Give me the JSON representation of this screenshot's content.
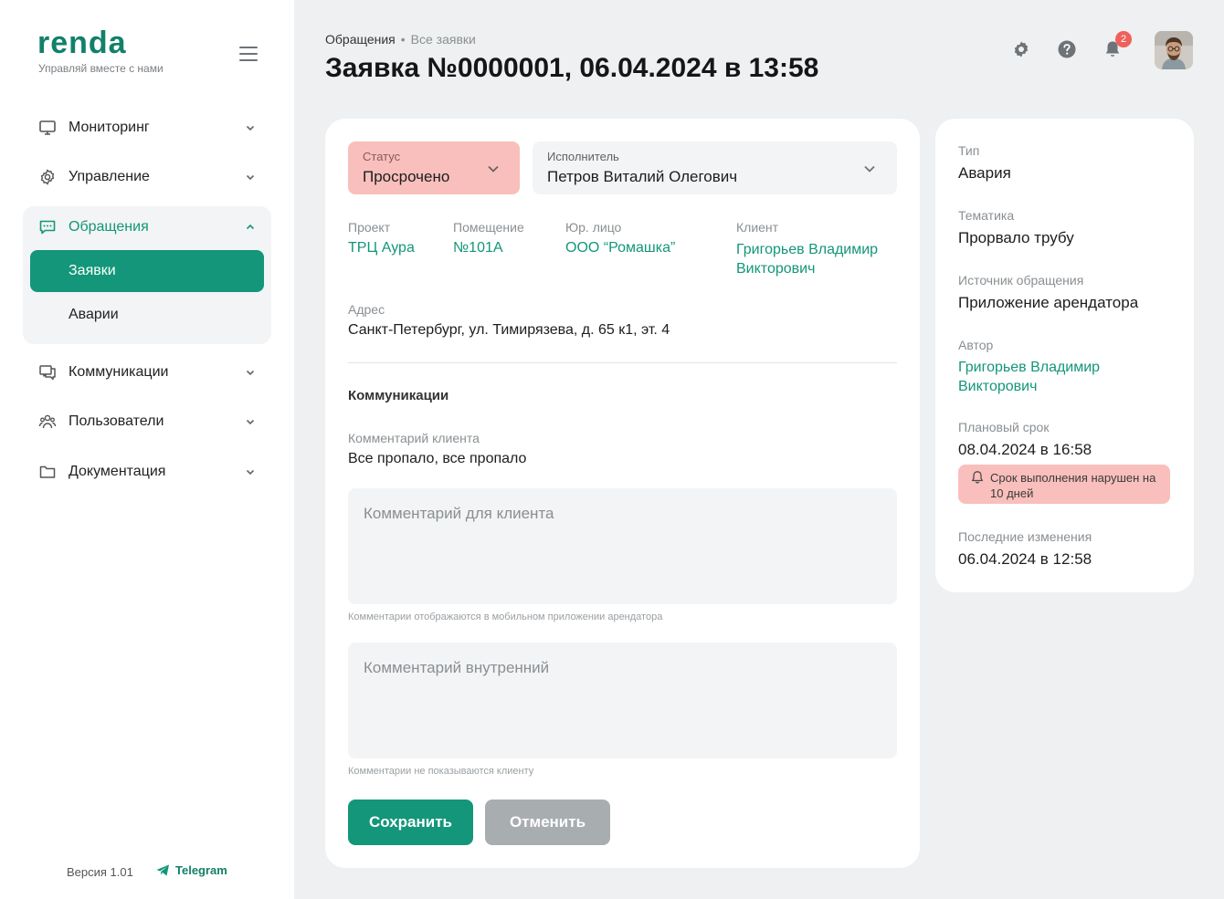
{
  "brand": {
    "logo": "renda",
    "tagline": "Управляй вместе с нами"
  },
  "sidebar": {
    "items": [
      {
        "label": "Мониторинг",
        "icon": "monitor-icon"
      },
      {
        "label": "Управление",
        "icon": "gear-icon"
      },
      {
        "label": "Обращения",
        "icon": "chat-icon",
        "expanded": true
      },
      {
        "label": "Коммуникации",
        "icon": "messages-icon"
      },
      {
        "label": "Пользователи",
        "icon": "users-icon"
      },
      {
        "label": "Документация",
        "icon": "folder-icon"
      }
    ],
    "subitems": [
      {
        "label": "Заявки",
        "active": true
      },
      {
        "label": "Аварии",
        "active": false
      }
    ],
    "version": "Версия 1.01",
    "telegram": "Telegram"
  },
  "header": {
    "breadcrumb": {
      "parent": "Обращения",
      "separator": "•",
      "current": "Все заявки"
    },
    "title": "Заявка №0000001, 06.04.2024 в 13:58",
    "notifications_count": "2"
  },
  "form": {
    "status": {
      "label": "Статус",
      "value": "Просрочено"
    },
    "executor": {
      "label": "Исполнитель",
      "value": "Петров Виталий Олегович"
    },
    "project": {
      "label": "Проект",
      "value": "ТРЦ Аура"
    },
    "room": {
      "label": "Помещение",
      "value": "№101А"
    },
    "legal": {
      "label": "Юр. лицо",
      "value": "ООО “Ромашка”"
    },
    "client": {
      "label": "Клиент",
      "value": "Григорьев Владимир Викторович"
    },
    "address": {
      "label": "Адрес",
      "value": "Санкт-Петербург, ул. Тимирязева, д. 65 к1, эт. 4"
    },
    "communications_title": "Коммуникации",
    "client_comment": {
      "label": "Комментарий клиента",
      "value": "Все пропало, все пропало"
    },
    "comment_for_client": {
      "placeholder": "Комментарий для клиента",
      "hint": "Комментарии отображаются в мобильном приложении арендатора"
    },
    "comment_internal": {
      "placeholder": "Комментарий внутренний",
      "hint": "Комментарии не показываются клиенту"
    },
    "save_label": "Сохранить",
    "cancel_label": "Отменить"
  },
  "details": {
    "type": {
      "label": "Тип",
      "value": "Авария"
    },
    "topic": {
      "label": "Тематика",
      "value": "Прорвало трубу"
    },
    "source": {
      "label": "Источник обращения",
      "value": "Приложение арендатора"
    },
    "author": {
      "label": "Автор",
      "value": "Григорьев Владимир Викторович"
    },
    "deadline": {
      "label": "Плановый срок",
      "value": "08.04.2024 в 16:58"
    },
    "warning": "Срок выполнения нарушен на 10 дней",
    "last_changed": {
      "label": "Последние изменения",
      "value": "06.04.2024 в 12:58"
    }
  },
  "colors": {
    "accent": "#139679",
    "danger_bg": "#f9bfbc",
    "badge": "#f0605a",
    "page_bg": "#eef0f1"
  }
}
